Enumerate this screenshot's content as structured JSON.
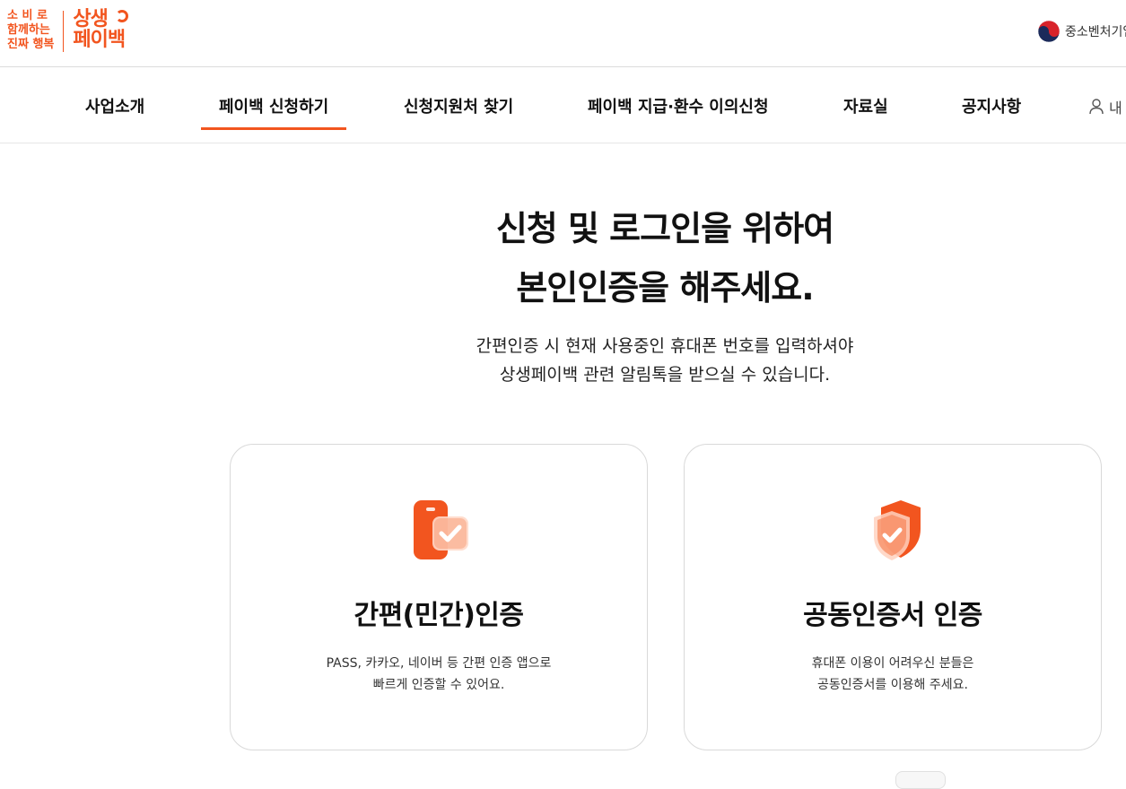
{
  "header": {
    "slogan_lines": [
      "소 비 로",
      "함께하는",
      "진짜 행복"
    ],
    "brand_lines": [
      "상생",
      "페이백"
    ],
    "ministry_label": "중소벤처기업"
  },
  "nav": {
    "items": [
      {
        "label": "사업소개"
      },
      {
        "label": "페이백 신청하기",
        "active": true
      },
      {
        "label": "신청지원처 찾기"
      },
      {
        "label": "페이백 지급·환수 이의신청"
      },
      {
        "label": "자료실"
      },
      {
        "label": "공지사항"
      }
    ],
    "user_label": "내"
  },
  "main": {
    "title_lines": [
      "신청 및 로그인을 위하여",
      "본인인증을 해주세요."
    ],
    "subtitle_lines": [
      "간편인증 시 현재 사용중인 휴대폰 번호를 입력하셔야",
      "상생페이백 관련 알림톡을 받으실 수 있습니다."
    ],
    "cards": [
      {
        "icon": "mobile-check-icon",
        "title": "간편(민간)인증",
        "desc_lines": [
          "PASS, 카카오, 네이버 등 간편 인증 앱으로",
          "빠르게 인증할 수 있어요."
        ]
      },
      {
        "icon": "shield-check-icon",
        "title": "공동인증서 인증",
        "desc_lines": [
          "휴대폰 이용이 어려우신 분들은",
          "공동인증서를 이용해 주세요."
        ]
      }
    ]
  },
  "colors": {
    "accent": "#f2551f",
    "text": "#111111",
    "border": "#d9d9d9"
  }
}
